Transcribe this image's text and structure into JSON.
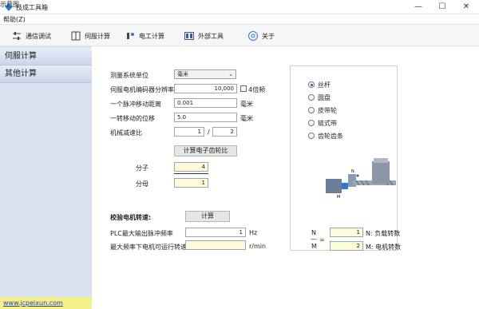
{
  "window": {
    "title": "技成工具箱",
    "minimize": "—",
    "maximize": "☐",
    "close": "✕"
  },
  "menu": {
    "help": "帮助(Z)"
  },
  "toolbar": {
    "items": [
      {
        "label": "通信调试",
        "icon": "sliders-icon"
      },
      {
        "label": "伺服计算",
        "icon": "book-icon"
      },
      {
        "label": "电工计算",
        "icon": "power-icon"
      },
      {
        "label": "外部工具",
        "icon": "window-icon"
      },
      {
        "label": "关于",
        "icon": "at-icon"
      }
    ]
  },
  "sidebar": {
    "items": [
      {
        "label": "伺服计算"
      },
      {
        "label": "其他计算"
      }
    ]
  },
  "footer": {
    "link": "www.jcpeixun.com"
  },
  "form": {
    "unit_label": "测量系统单位",
    "unit_value": "毫米",
    "encoder_label": "伺服电机编码器分辨率",
    "encoder_value": "10,000",
    "quad_label": "4倍频",
    "pulse_dist_label": "一个脉冲移动距离",
    "pulse_dist_value": "0.001",
    "pulse_dist_unit": "毫米",
    "rev_dist_label": "一转移动的位移",
    "rev_dist_value": "5.0",
    "rev_dist_unit": "毫米",
    "ratio_label": "机械减速比",
    "ratio_num": "1",
    "ratio_sep": "/",
    "ratio_den": "2",
    "calc_gear_button": "计算电子齿轮比",
    "numerator_label": "分子",
    "numerator_value": "4",
    "denominator_label": "分母",
    "denominator_value": "1"
  },
  "verify": {
    "title": "校验电机转速:",
    "calc_button": "计算",
    "plc_label": "PLC最大输出脉冲频率",
    "plc_value": "1",
    "plc_unit": "Hz",
    "speed_label": "最大频率下电机可运行转速",
    "speed_value": "",
    "speed_unit": "r/min"
  },
  "diagram": {
    "title": "示意图",
    "options": [
      "丝杆",
      "圆盘",
      "皮带轮",
      "链式带",
      "齿轮齿条"
    ],
    "selected": 0,
    "label_n": "N",
    "label_m": "M",
    "eq_sign": "=",
    "n_value": "1",
    "n_desc": "N: 负载转数",
    "m_value": "2",
    "m_desc": "M: 电机转数"
  }
}
